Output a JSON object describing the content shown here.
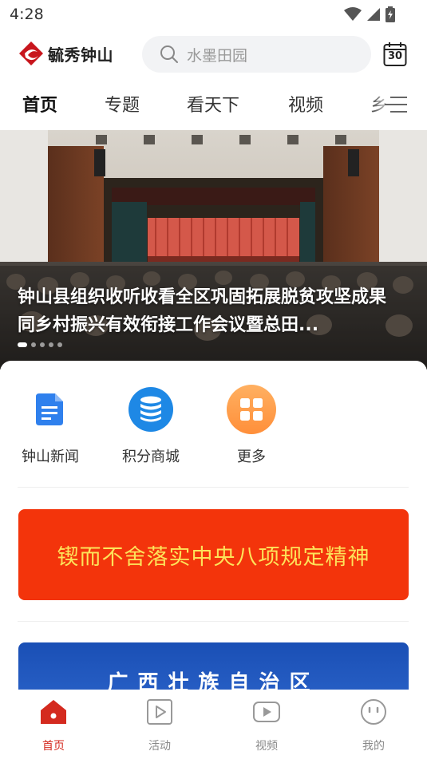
{
  "status_bar": {
    "time": "4:28"
  },
  "header": {
    "logo_text": "毓秀钟山",
    "search_placeholder": "水墨田园",
    "calendar_day": "30"
  },
  "tabs": [
    {
      "label": "首页",
      "active": true
    },
    {
      "label": "专题"
    },
    {
      "label": "看天下"
    },
    {
      "label": "视频"
    },
    {
      "label": "乡"
    }
  ],
  "banner": {
    "caption": "钟山县组织收听收看全区巩固拓展脱贫攻坚成果同乡村振兴有效衔接工作会议暨总田...",
    "slide_count": 5,
    "active_slide": 1
  },
  "quick_links": [
    {
      "label": "钟山新闻",
      "icon": "document-icon",
      "color": "#2f80ed"
    },
    {
      "label": "积分商城",
      "icon": "database-icon",
      "color": "#1e88e5"
    },
    {
      "label": "更多",
      "icon": "grid-icon",
      "color": "#ff9a3c"
    }
  ],
  "promo": {
    "text": "锲而不舍落实中央八项规定精神",
    "bg_color": "#f3340b",
    "text_color": "#fde35a"
  },
  "gx_banner": {
    "text": "广西壮族自治区"
  },
  "bottom_nav": [
    {
      "label": "首页",
      "icon": "home-icon",
      "active": true
    },
    {
      "label": "活动",
      "icon": "play-square-icon"
    },
    {
      "label": "视频",
      "icon": "video-icon"
    },
    {
      "label": "我的",
      "icon": "profile-icon"
    }
  ],
  "colors": {
    "accent": "#d42a1f"
  }
}
